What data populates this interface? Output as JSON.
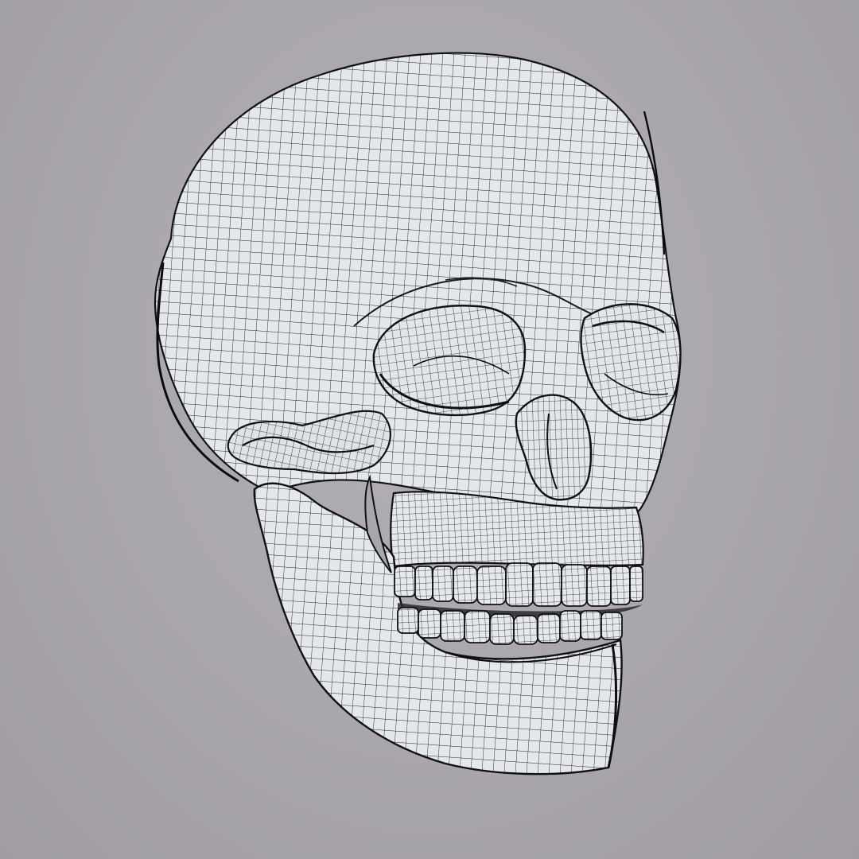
{
  "scene": {
    "subject": "skull-wireframe-mesh",
    "background_color": "#aaa6ad",
    "surface_color": "#e6eaec",
    "wire_color": "#1f1f22",
    "shadow_color": "#2a2a2e"
  }
}
